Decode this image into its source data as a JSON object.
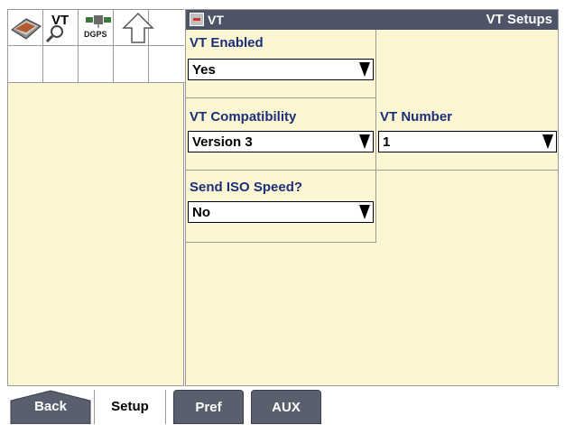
{
  "toolbar": {
    "icons": [
      {
        "name": "book-icon"
      },
      {
        "name": "vt-magnify-icon",
        "label": "VT"
      },
      {
        "name": "dgps-icon",
        "label": "DGPS"
      },
      {
        "name": "up-arrow-icon"
      }
    ]
  },
  "panel": {
    "app_label": "VT",
    "title": "VT Setups"
  },
  "settings": {
    "vt_enabled": {
      "label": "VT Enabled",
      "value": "Yes"
    },
    "vt_compatibility": {
      "label": "VT Compatibility",
      "value": "Version 3"
    },
    "vt_number": {
      "label": "VT Number",
      "value": "1"
    },
    "send_iso_speed": {
      "label": "Send ISO Speed?",
      "value": "No"
    }
  },
  "tabs": [
    {
      "label": "Back",
      "state": "inactive"
    },
    {
      "label": "Setup",
      "state": "active"
    },
    {
      "label": "Pref",
      "state": "inactive"
    },
    {
      "label": "AUX",
      "state": "inactive"
    }
  ],
  "colors": {
    "panel_bg": "#fdf6d3",
    "title_bar": "#4e5468",
    "label_text": "#1b2f7a",
    "tab_inactive": "#5a5f6e"
  }
}
